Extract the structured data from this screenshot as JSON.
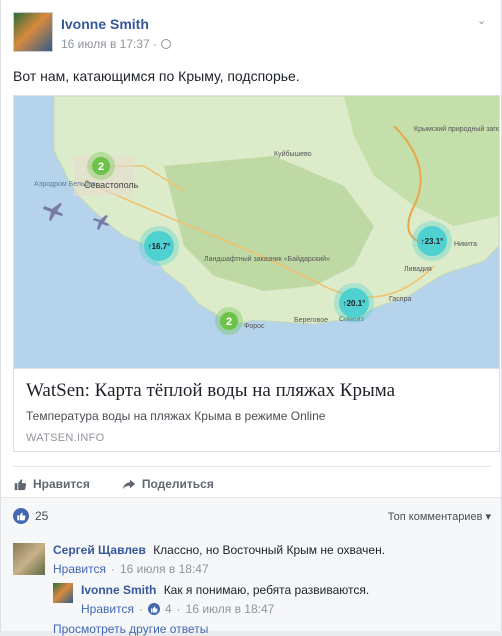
{
  "post": {
    "author": "Ivonne Smith",
    "time": "16 июля в 17:37 ·",
    "text": "Вот нам, катающимся по Крыму, подспорье."
  },
  "link": {
    "title": "WatSen: Карта тёплой воды на пляжах Крыма",
    "description": "Температура воды на пляжах Крыма в режиме Online",
    "domain": "WATSEN.INFO"
  },
  "map": {
    "labels": {
      "sevastopol": "Севастополь",
      "airport": "Аэродром Бельбек",
      "kuibyshevo": "Куйбышево",
      "reserve": "Ландшафтный заказник «Байдарский»",
      "crimean_reserve": "Крымский природный заповедник",
      "nikita": "Никита",
      "livadiya": "Ливадия",
      "gaspra": "Гаспра",
      "beregovoe": "Береговое",
      "simeiz": "Симеиз",
      "foros": "Форос"
    },
    "clusters": [
      {
        "label": "2",
        "color": "#6cc24a"
      },
      {
        "label": "2",
        "color": "#6cc24a"
      }
    ],
    "temps": [
      {
        "label": "↑16.7°"
      },
      {
        "label": "↑20.1°"
      },
      {
        "label": "↑23.1°"
      }
    ]
  },
  "actions": {
    "like": "Нравится",
    "share": "Поделиться"
  },
  "stats": {
    "likes": "25",
    "sort": "Топ комментариев ▾"
  },
  "comments": [
    {
      "author": "Сергей Щавлев",
      "text": "Классно, но Восточный Крым не охвачен.",
      "like": "Нравится",
      "time": "16 июля в 18:47"
    },
    {
      "author": "Ivonne Smith",
      "text": "Как я понимаю, ребята развиваются.",
      "like": "Нравится",
      "likes": "4",
      "time": "16 июля в 18:47"
    }
  ],
  "more_replies": "Просмотреть другие ответы",
  "colors": {
    "link_blue": "#365899",
    "accent": "#4267b2",
    "muted": "#90949c",
    "temp_marker": "#4fd1d1"
  }
}
